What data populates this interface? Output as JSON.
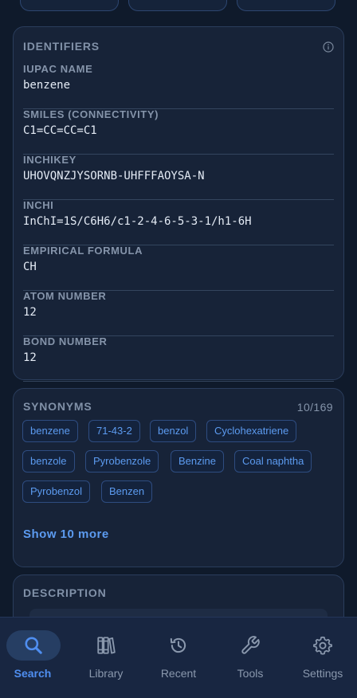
{
  "identifiers": {
    "title": "IDENTIFIERS",
    "fields": [
      {
        "label": "IUPAC NAME",
        "value": "benzene"
      },
      {
        "label": "SMILES (CONNECTIVITY)",
        "value": "C1=CC=CC=C1"
      },
      {
        "label": "INCHIKEY",
        "value": "UHOVQNZJYSORNB-UHFFFAOYSA-N"
      },
      {
        "label": "INCHI",
        "value": "InChI=1S/C6H6/c1-2-4-6-5-3-1/h1-6H"
      },
      {
        "label": "EMPIRICAL FORMULA",
        "value": "CH"
      },
      {
        "label": "ATOM NUMBER",
        "value": "12"
      },
      {
        "label": "BOND NUMBER",
        "value": "12"
      }
    ]
  },
  "synonyms": {
    "title": "SYNONYMS",
    "count": "10/169",
    "items": [
      "benzene",
      "71-43-2",
      "benzol",
      "Cyclohexatriene",
      "benzole",
      "Pyrobenzole",
      "Benzine",
      "Coal naphtha",
      "Pyrobenzol",
      "Benzen"
    ],
    "show_more": "Show 10 more"
  },
  "description": {
    "title": "DESCRIPTION"
  },
  "nav": {
    "items": [
      {
        "label": "Search",
        "icon": "search-icon",
        "active": true
      },
      {
        "label": "Library",
        "icon": "library-icon",
        "active": false
      },
      {
        "label": "Recent",
        "icon": "history-icon",
        "active": false
      },
      {
        "label": "Tools",
        "icon": "wrench-icon",
        "active": false
      },
      {
        "label": "Settings",
        "icon": "gear-icon",
        "active": false
      }
    ]
  },
  "colors": {
    "background": "#0f1a2b",
    "card": "#172338",
    "accent": "#4f8ef0",
    "muted": "#8594aa"
  }
}
